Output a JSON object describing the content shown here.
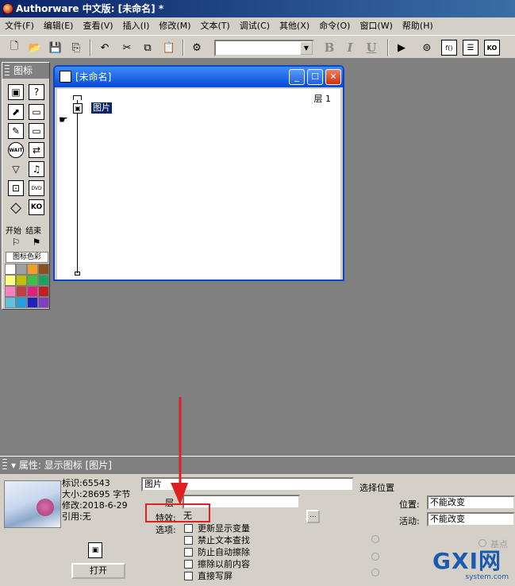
{
  "titlebar": {
    "title": "Authorware 中文版: [未命名] *"
  },
  "menubar": {
    "items": [
      "文件(F)",
      "编辑(E)",
      "查看(V)",
      "插入(I)",
      "修改(M)",
      "文本(T)",
      "调试(C)",
      "其他(X)",
      "命令(O)",
      "窗口(W)",
      "帮助(H)"
    ]
  },
  "toolbar": {
    "font_value": "",
    "bold": "B",
    "italic": "I",
    "underline": "U",
    "icons": [
      "new-icon",
      "open-icon",
      "save-icon",
      "import-icon",
      "undo-icon",
      "cut-icon",
      "copy-icon",
      "paste-icon",
      "find-icon",
      "restart-icon",
      "control-panel-icon",
      "functions-icon",
      "variables-icon",
      "knowledge-objects-icon"
    ]
  },
  "palette": {
    "title": "图标",
    "start_label": "开始",
    "end_label": "结束",
    "color_label": "图标色彩",
    "swatches": [
      "#ffffff",
      "#a0a0a0",
      "#f0a020",
      "#8a5020",
      "#ffff80",
      "#c0c000",
      "#40c040",
      "#20a060",
      "#ff80c0",
      "#c04040",
      "#e02080",
      "#c02020",
      "#60c0e0",
      "#20a0e0",
      "#2020c0",
      "#8040c0"
    ]
  },
  "flowwin": {
    "title": "[未命名]",
    "layer": "层 1",
    "icon_label": "图片"
  },
  "props": {
    "title": "属性: 显示图标 [图片]",
    "id_line": "标识:65543",
    "size_line": "大小:28695 字节",
    "modified_line": "修改:2018-6-29",
    "ref_line": "引用:无",
    "name_value": "图片",
    "layer_label": "层",
    "layer_value": "",
    "effect_label": "特效:",
    "effect_value": "无",
    "options_label": "选项:",
    "options": [
      "更新显示变量",
      "禁止文本查找",
      "防止自动擦除",
      "擦除以前内容",
      "直接写屏"
    ],
    "select_position_label": "选择位置",
    "position_label": "位置:",
    "position_value": "不能改变",
    "active_label": "活动:",
    "active_value": "不能改变",
    "base_point_label": "基点",
    "open_button": "打开",
    "browse_button": "..."
  },
  "watermark": {
    "main": "GXI网",
    "sub": "system.com"
  }
}
